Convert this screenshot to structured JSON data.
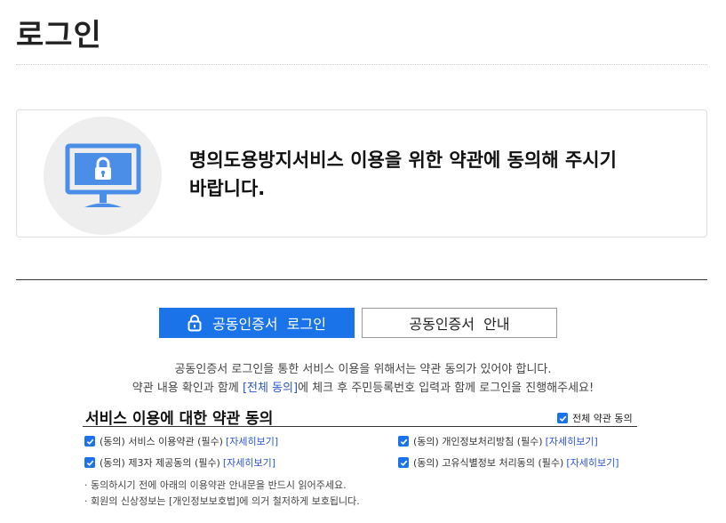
{
  "page": {
    "title": "로그인"
  },
  "notice": {
    "line1": "명의도용방지서비스 이용을 위한 약관에 동의해 주시기",
    "line2": "바랍니다.",
    "icon": "monitor-lock-icon"
  },
  "tabs": [
    {
      "label": "공동인증서  로그인",
      "active": true
    },
    {
      "label": "공동인증서  안내",
      "active": false
    }
  ],
  "intro": {
    "line1": "공동인증서 로그인을 통한 서비스 이용을 위해서는 약관 동의가 있어야 합니다.",
    "line2_pre": "약관 내용 확인과 함께 ",
    "line2_link": "[전체 동의]",
    "line2_post": "에 체크 후 주민등록번호 입력과 함께 로그인을 진행해주세요!"
  },
  "terms": {
    "title": "서비스 이용에 대한 약관 동의",
    "check_all_label": "전체 약관 동의",
    "check_all_checked": true,
    "items": [
      {
        "label": "(동의) 서비스 이용약관 (필수)",
        "detail": "[자세히보기]",
        "checked": true
      },
      {
        "label": "(동의) 개인정보처리방침 (필수)",
        "detail": "[자세히보기]",
        "checked": true
      },
      {
        "label": "(동의) 제3자 제공동의 (필수)",
        "detail": "[자세히보기]",
        "checked": true
      },
      {
        "label": "(동의) 고유식별정보 처리동의 (필수)",
        "detail": "[자세히보기]",
        "checked": true
      }
    ]
  },
  "notes": [
    "· 동의하시기 전에 아래의 이용약관 안내문을 반드시 읽어주세요.",
    "· 회원의 신상정보는 [개인정보보호법]에 의거 철저하게 보호됩니다."
  ],
  "colors": {
    "accent": "#1a73e8",
    "link": "#2b56c7",
    "icon": "#4a8ee8"
  }
}
